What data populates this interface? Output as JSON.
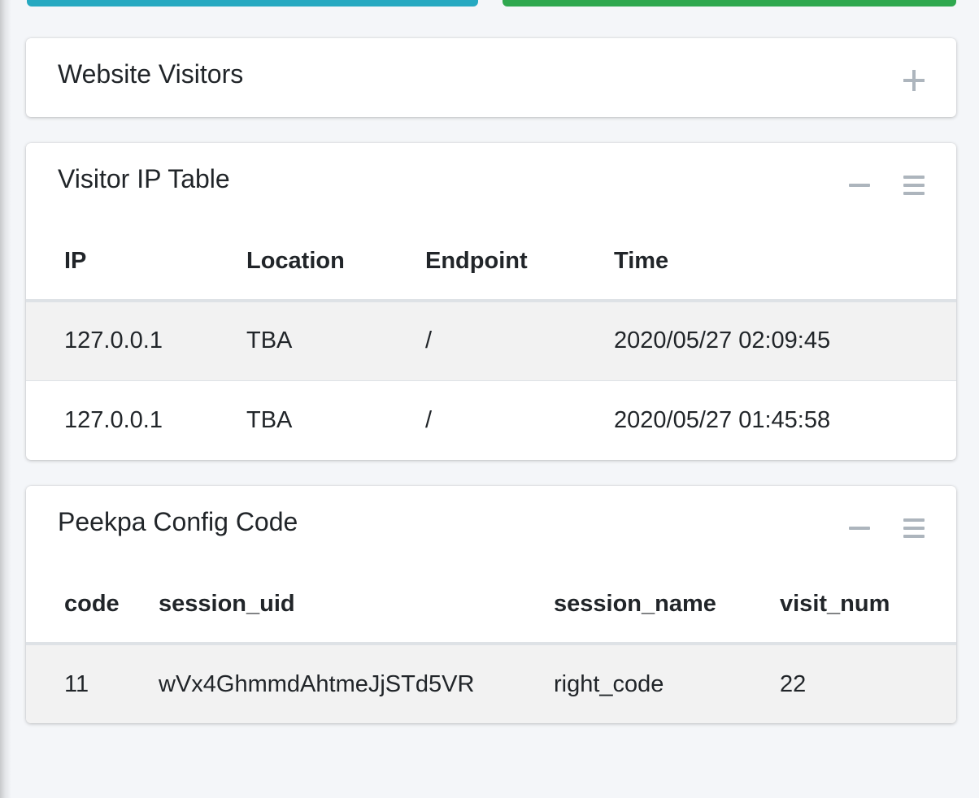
{
  "top_bars": {
    "left_color": "#26a9c1",
    "right_color": "#2fa84f"
  },
  "visitors_card": {
    "title": "Website Visitors",
    "expand_icon": "plus-icon"
  },
  "ip_card": {
    "title": "Visitor IP Table",
    "collapse_icon": "minus-icon",
    "menu_icon": "menu-icon",
    "columns": [
      "IP",
      "Location",
      "Endpoint",
      "Time"
    ],
    "rows": [
      [
        "127.0.0.1",
        "TBA",
        "/",
        "2020/05/27 02:09:45"
      ],
      [
        "127.0.0.1",
        "TBA",
        "/",
        "2020/05/27 01:45:58"
      ]
    ]
  },
  "config_card": {
    "title": "Peekpa Config Code",
    "collapse_icon": "minus-icon",
    "menu_icon": "menu-icon",
    "columns": [
      "code",
      "session_uid",
      "session_name",
      "visit_num"
    ],
    "rows": [
      [
        "11",
        "wVx4GhmmdAhtmeJjSTd5VR",
        "right_code",
        "22"
      ]
    ]
  }
}
